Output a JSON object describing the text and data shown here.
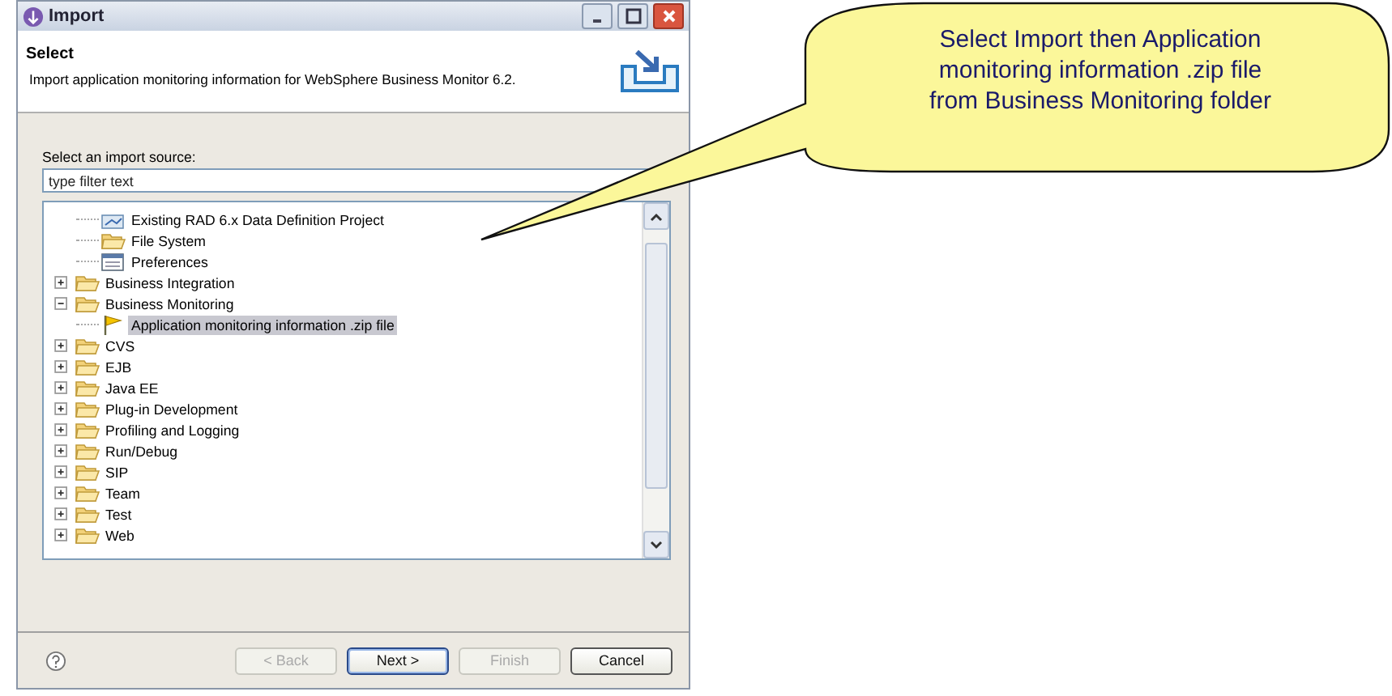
{
  "window": {
    "title": "Import"
  },
  "header": {
    "title": "Select",
    "description": "Import application monitoring information for WebSphere Business Monitor 6.2."
  },
  "source_label": "Select an import source:",
  "filter": {
    "placeholder": "type filter text"
  },
  "tree": [
    {
      "kind": "cut-parent",
      "children": [
        {
          "label": "Existing RAD 6.x Data Definition Project",
          "selected": false
        },
        {
          "label": "File System",
          "selected": false
        },
        {
          "label": "Preferences",
          "selected": false
        }
      ]
    },
    {
      "label": "Business Integration",
      "expanded": false,
      "selected": false
    },
    {
      "label": "Business Monitoring",
      "expanded": true,
      "selected": false,
      "children": [
        {
          "label": "Application monitoring information .zip file",
          "selected": true
        }
      ]
    },
    {
      "label": "CVS",
      "expanded": false,
      "selected": false
    },
    {
      "label": "EJB",
      "expanded": false,
      "selected": false
    },
    {
      "label": "Java EE",
      "expanded": false,
      "selected": false
    },
    {
      "label": "Plug-in Development",
      "expanded": false,
      "selected": false
    },
    {
      "label": "Profiling and Logging",
      "expanded": false,
      "selected": false
    },
    {
      "label": "Run/Debug",
      "expanded": false,
      "selected": false
    },
    {
      "label": "SIP",
      "expanded": false,
      "selected": false
    },
    {
      "label": "Team",
      "expanded": false,
      "selected": false
    },
    {
      "label": "Test",
      "expanded": false,
      "selected": false
    },
    {
      "label": "Web",
      "expanded": false,
      "selected": false
    }
  ],
  "buttons": [
    {
      "label": "< Back",
      "disabled": true,
      "default": false
    },
    {
      "label": "Next >",
      "disabled": false,
      "default": true
    },
    {
      "label": "Finish",
      "disabled": true,
      "default": false
    },
    {
      "label": "Cancel",
      "disabled": false,
      "default": false
    }
  ],
  "callout": {
    "text": "Select Import then Application monitoring information .zip file from Business Monitoring folder"
  }
}
